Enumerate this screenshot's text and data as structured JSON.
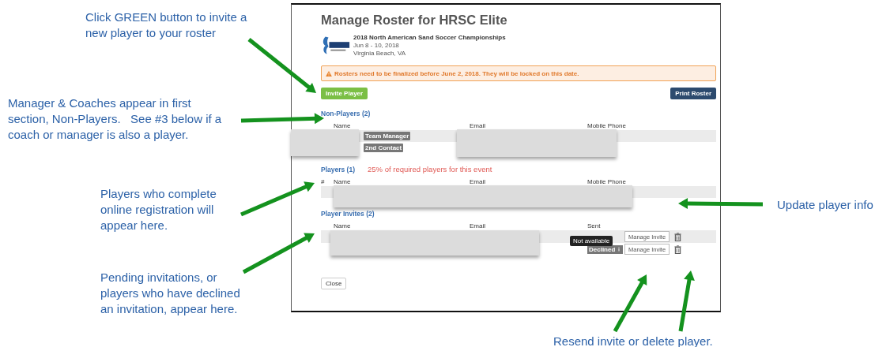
{
  "annotations": [
    {
      "text": "Click GREEN button to invite a new player to your roster"
    },
    {
      "text": "Manager & Coaches appear in first section, Non-Players.   See #3 below if a coach or manager is also a player."
    },
    {
      "text": "Players who complete online registration will appear here."
    },
    {
      "text": "Pending invitations, or players who have declined an invitation, appear here."
    },
    {
      "text": "Update player info"
    },
    {
      "text": "Resend invite or delete player."
    }
  ],
  "roster": {
    "title": "Manage Roster for HRSC Elite",
    "event": {
      "name": "2018 North American Sand Soccer Championships",
      "dates": "Jun 8 - 10, 2018",
      "location": "Virginia Beach, VA"
    },
    "alert": "Rosters need to be finalized before June 2, 2018. They will be locked on this date.",
    "invite_button": "Invite Player",
    "print_button": "Print Roster",
    "non_players": {
      "heading": "Non-Players (2)",
      "columns": [
        "Name",
        "Email",
        "Mobile Phone"
      ],
      "rows": [
        {
          "badge": "Team Manager"
        },
        {
          "badge": "2nd Contact"
        }
      ]
    },
    "players": {
      "heading": "Players (1)",
      "requirement": "25% of required players for this event",
      "columns": [
        "#",
        "Name",
        "Email",
        "Mobile Phone"
      ]
    },
    "invites": {
      "heading": "Player Invites (2)",
      "columns": [
        "Name",
        "Email",
        "Sent"
      ],
      "rows": [
        {
          "action": "Manage Invite"
        },
        {
          "status": "Declined",
          "tooltip": "Not available",
          "action": "Manage Invite"
        }
      ]
    },
    "close_button": "Close"
  }
}
